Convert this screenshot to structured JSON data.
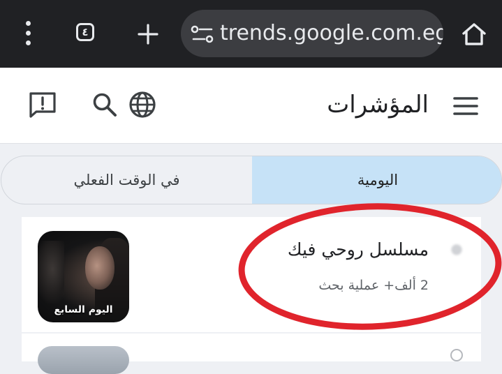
{
  "browser": {
    "tab_count": "٤",
    "url": "trends.google.com.eg/"
  },
  "appbar": {
    "title": "المؤشرات"
  },
  "tabs": [
    {
      "label": "في الوقت الفعلي",
      "selected": false
    },
    {
      "label": "اليومية",
      "selected": true
    }
  ],
  "trends": [
    {
      "title": "مسلسل روحي فيك",
      "searches": "2 ألف+ عملية بحث",
      "image_caption": "اليوم السابع"
    }
  ],
  "colors": {
    "chrome_bg": "#202124",
    "omnibox_bg": "#3c3d41",
    "selected_tab_bg": "#c6e2f7",
    "highlight_ellipse": "#e0242c"
  }
}
